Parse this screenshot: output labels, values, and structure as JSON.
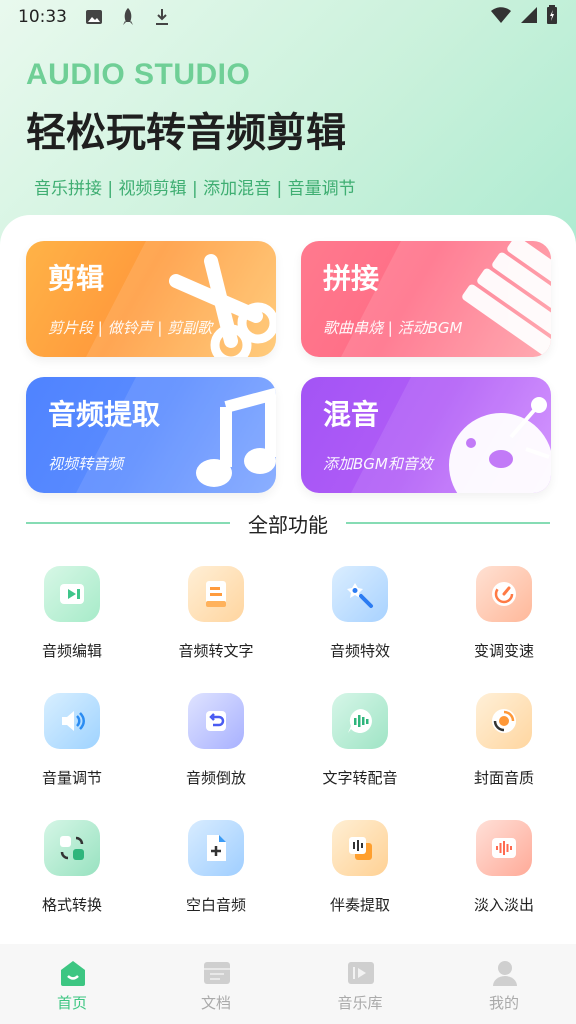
{
  "status_bar": {
    "time": "10:33"
  },
  "hero": {
    "en_title": "AUDIO STUDIO",
    "title": "轻松玩转音频剪辑",
    "subtitle": "音乐拼接 | 视频剪辑 | 添加混音 | 音量调节"
  },
  "cards": [
    {
      "title": "剪辑",
      "subtitle": "剪片段 | 做铃声 | 剪副歌",
      "icon": "scissors-icon"
    },
    {
      "title": "拼接",
      "subtitle": "歌曲串烧 | 活动BGM",
      "icon": "stack-icon"
    },
    {
      "title": "音频提取",
      "subtitle": "视频转音频",
      "icon": "music-note-icon"
    },
    {
      "title": "混音",
      "subtitle": "添加BGM和音效",
      "icon": "mix-icon"
    }
  ],
  "section_title": "全部功能",
  "features": [
    {
      "label": "音频编辑",
      "icon": "play-box-icon",
      "color": "#7ddcae"
    },
    {
      "label": "音频转文字",
      "icon": "document-icon",
      "color": "#ffc27a"
    },
    {
      "label": "音频特效",
      "icon": "magic-wand-icon",
      "color": "#7ab8ff"
    },
    {
      "label": "变调变速",
      "icon": "speedometer-icon",
      "color": "#ff9a6a"
    },
    {
      "label": "音量调节",
      "icon": "speaker-icon",
      "color": "#6fc1ff"
    },
    {
      "label": "音频倒放",
      "icon": "rewind-icon",
      "color": "#7d8cff"
    },
    {
      "label": "文字转配音",
      "icon": "voice-bubble-icon",
      "color": "#73d8ae"
    },
    {
      "label": "封面音质",
      "icon": "disc-icon",
      "color": "#ffc07a"
    },
    {
      "label": "格式转换",
      "icon": "convert-icon",
      "color": "#6bd8a8"
    },
    {
      "label": "空白音频",
      "icon": "new-file-icon",
      "color": "#6fb8ff"
    },
    {
      "label": "伴奏提取",
      "icon": "accompaniment-icon",
      "color": "#ffbe6b"
    },
    {
      "label": "淡入淡出",
      "icon": "waveform-icon",
      "color": "#ff8e7a"
    }
  ],
  "nav": [
    {
      "label": "首页",
      "icon": "home-icon",
      "active": true
    },
    {
      "label": "文档",
      "icon": "document-tray-icon",
      "active": false
    },
    {
      "label": "音乐库",
      "icon": "music-library-icon",
      "active": false
    },
    {
      "label": "我的",
      "icon": "profile-icon",
      "active": false
    }
  ],
  "colors": {
    "accent": "#3dc682",
    "hero_en": "#6fcf96"
  }
}
